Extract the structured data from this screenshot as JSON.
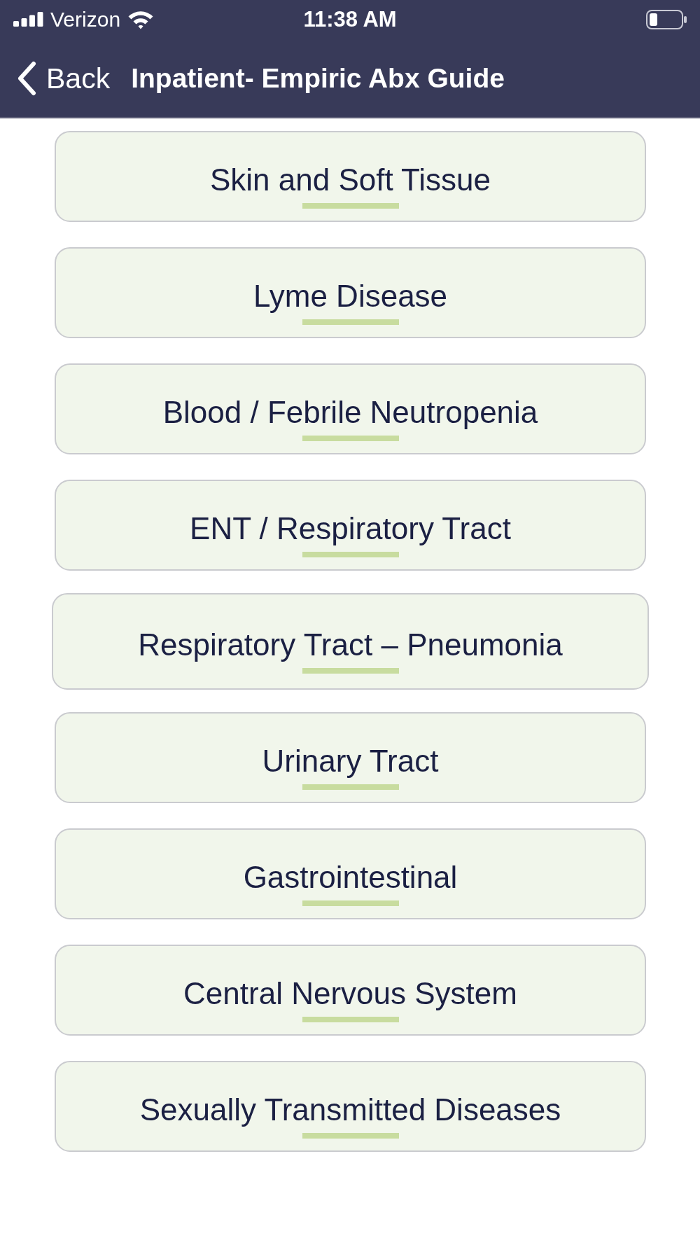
{
  "status_bar": {
    "carrier": "Verizon",
    "time": "11:38 AM"
  },
  "nav_bar": {
    "back_label": "Back",
    "title": "Inpatient- Empiric Abx Guide"
  },
  "categories": [
    {
      "label": "Skin and Soft Tissue",
      "selected": false
    },
    {
      "label": "Lyme Disease",
      "selected": false
    },
    {
      "label": "Blood / Febrile Neutropenia",
      "selected": false
    },
    {
      "label": "ENT / Respiratory Tract",
      "selected": false
    },
    {
      "label": "Respiratory Tract – Pneumonia",
      "selected": true
    },
    {
      "label": "Urinary Tract",
      "selected": false
    },
    {
      "label": "Gastrointestinal",
      "selected": false
    },
    {
      "label": "Central Nervous System",
      "selected": false
    },
    {
      "label": "Sexually Transmitted Diseases",
      "selected": false
    }
  ]
}
